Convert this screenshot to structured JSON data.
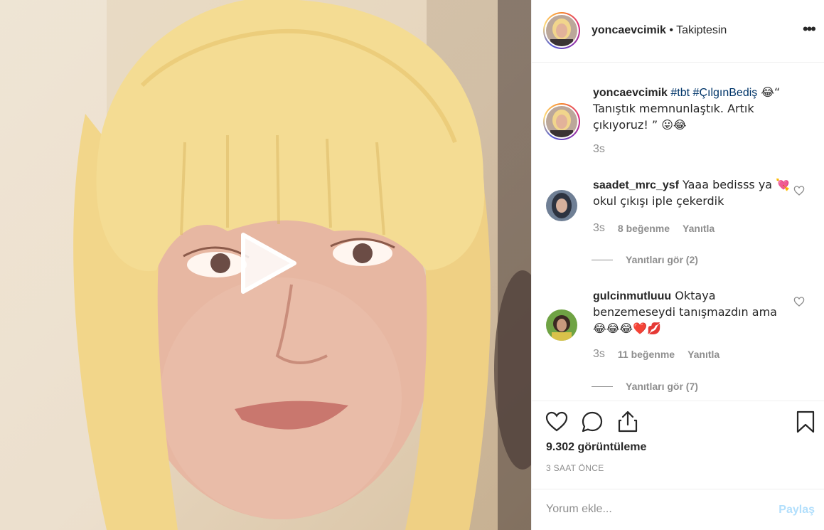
{
  "post": {
    "username": "yoncaevcimik",
    "follow_status": "• Takiptesin",
    "more_label": "•••"
  },
  "caption": {
    "username": "yoncaevcimik",
    "hashtag1": "#tbt",
    "hashtag2": "#ÇılgınBediş",
    "text_a": " 😂“ Tanıştık memnunlaştık. Artık çıkıyoruz! ” 😛😂",
    "time": "3s"
  },
  "comments": [
    {
      "username": "saadet_mrc_ysf",
      "text": " Yaaa bedisss ya 💘 okul çıkışı iple çekerdik",
      "time": "3s",
      "likes": "8 beğenme",
      "reply": "Yanıtla",
      "view_replies": "Yanıtları gör (2)"
    },
    {
      "username": "gulcinmutluuu",
      "text": " Oktaya benzemeseydi tanışmazdın ama 😂😂😂❤️💋",
      "time": "3s",
      "likes": "11 beğenme",
      "reply": "Yanıtla",
      "view_replies": "Yanıtları gör (7)"
    }
  ],
  "stats": {
    "views": "9.302 görüntüleme",
    "time_ago": "3 SAAT ÖNCE"
  },
  "comment_box": {
    "placeholder": "Yorum ekle...",
    "post_label": "Paylaş"
  },
  "colors": {
    "hashtag": "#003569",
    "muted": "#8e8e8e",
    "post_button": "#b2dffc"
  },
  "icons": {
    "like": "heart-icon",
    "comment": "speech-bubble-icon",
    "share": "share-icon",
    "save": "bookmark-icon",
    "play": "play-icon"
  }
}
